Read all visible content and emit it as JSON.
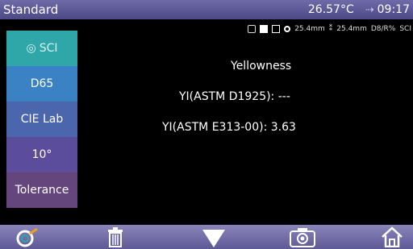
{
  "header": {
    "mode": "Standard",
    "temperature": "26.57°C",
    "time": "09:17"
  },
  "status": {
    "aperture1": "25.4mm",
    "aperture2": "25.4mm",
    "geometry": "D8/R%",
    "spec": "SCI"
  },
  "sidebar": {
    "items": [
      {
        "label": "SCI"
      },
      {
        "label": "D65"
      },
      {
        "label": "CIE Lab"
      },
      {
        "label": "10°"
      },
      {
        "label": "Tolerance"
      }
    ]
  },
  "main": {
    "title": "Yellowness",
    "yi_d1925": "YI(ASTM D1925): ---",
    "yi_e313": "YI(ASTM E313-00): 3.63"
  },
  "icons": {
    "toolbar": [
      "target-icon",
      "trash-icon",
      "down-arrow-icon",
      "camera-icon",
      "home-icon"
    ]
  },
  "colors": {
    "titlebar": "#5a5593",
    "sidebar_sci": "#2fa6a8",
    "sidebar_d65": "#3b82c4",
    "sidebar_lab": "#4b66ad",
    "sidebar_angle": "#5b4d9c",
    "sidebar_tolerance": "#64457c"
  }
}
